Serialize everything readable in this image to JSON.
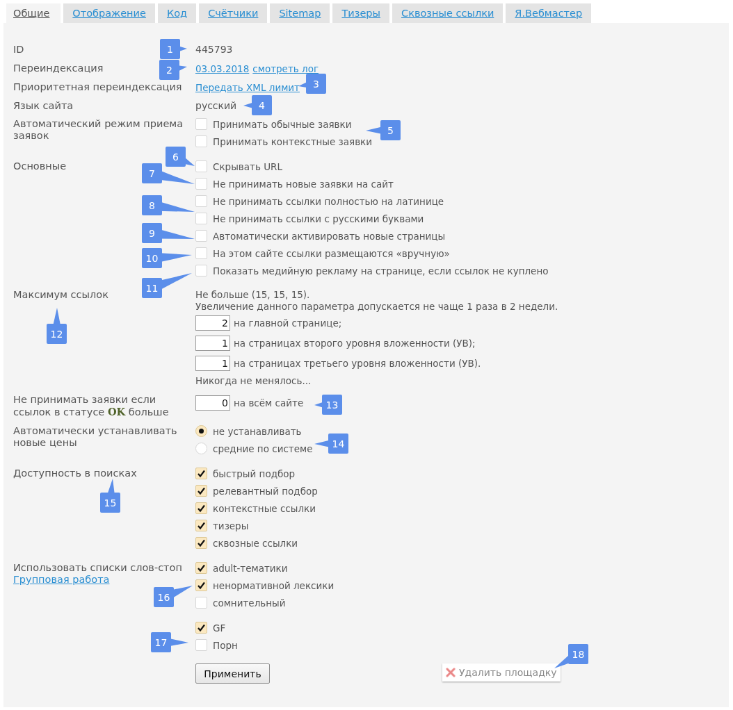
{
  "tabs": [
    {
      "label": "Общие",
      "selected": true
    },
    {
      "label": "Отображение",
      "selected": false
    },
    {
      "label": "Код",
      "selected": false
    },
    {
      "label": "Счётчики",
      "selected": false
    },
    {
      "label": "Sitemap",
      "selected": false
    },
    {
      "label": "Тизеры",
      "selected": false
    },
    {
      "label": "Сквозные ссылки",
      "selected": false
    },
    {
      "label": "Я.Вебмастер",
      "selected": false
    }
  ],
  "fields": [
    {
      "kind": "text",
      "label": "ID",
      "value": "445793"
    },
    {
      "kind": "links",
      "label": "Переиндексация",
      "links": [
        "03.03.2018",
        "смотреть лог"
      ]
    },
    {
      "kind": "links",
      "label": "Приоритетная переиндексация",
      "links": [
        "Передать XML лимит"
      ]
    },
    {
      "kind": "text",
      "label": "Язык сайта",
      "value": "русский"
    },
    {
      "kind": "checkboxes",
      "label": "Автоматический режим приема заявок",
      "options": [
        {
          "label": "Принимать обычные заявки",
          "checked": false
        },
        {
          "label": "Принимать контекстные заявки",
          "checked": false
        }
      ]
    },
    {
      "kind": "checkboxes",
      "label": "Основные",
      "options": [
        {
          "label": "Скрывать URL",
          "checked": false
        },
        {
          "label": "Не принимать новые заявки на сайт",
          "checked": false
        },
        {
          "label": "Не принимать ссылки полностью на латинице",
          "checked": false
        },
        {
          "label": "Не принимать ссылки с русскими буквами",
          "checked": false
        },
        {
          "label": "Автоматически активировать новые страницы",
          "checked": false
        },
        {
          "label": "На этом сайте ссылки размещаются «вручную»",
          "checked": false
        },
        {
          "label": "Показать медийную рекламу на странице, если ссылок не куплено",
          "checked": false
        }
      ]
    },
    {
      "kind": "limits",
      "label": "Максимум ссылок",
      "notes": [
        "Не больше (15, 15, 15).",
        "Увеличение данного параметра допускается не чаще 1 раза в 2 недели."
      ],
      "inputs": [
        {
          "value": "2",
          "caption": "на главной странице;"
        },
        {
          "value": "1",
          "caption": "на страницах второго уровня вложенности (УВ);"
        },
        {
          "value": "1",
          "caption": "на страницах третьего уровня вложенности (УВ)."
        }
      ],
      "footer": "Никогда не менялось..."
    },
    {
      "kind": "inputs",
      "label": "Не принимать заявки если ссылок в статусе **OK** больше",
      "inputs": [
        {
          "value": "0",
          "caption": "на всём сайте"
        }
      ]
    },
    {
      "kind": "radios",
      "label": "Автоматически устанавливать новые цены",
      "options": [
        {
          "label": "не устанавливать",
          "selected": true
        },
        {
          "label": "средние по системе",
          "selected": false
        }
      ]
    },
    {
      "kind": "checkboxes",
      "label": "Доступность в поисках",
      "options": [
        {
          "label": "быстрый подбор",
          "checked": true
        },
        {
          "label": "релевантный подбор",
          "checked": true
        },
        {
          "label": "контекстные ссылки",
          "checked": true
        },
        {
          "label": "тизеры",
          "checked": true
        },
        {
          "label": "сквозные ссылки",
          "checked": true
        }
      ]
    },
    {
      "kind": "checkboxes",
      "label": "Использовать списки слов-стоп",
      "link": "Групповая работа",
      "options": [
        {
          "label": "adult-тематики",
          "checked": true
        },
        {
          "label": "ненормативной лексики",
          "checked": true
        },
        {
          "label": "сомнительный",
          "checked": false
        }
      ]
    },
    {
      "kind": "checkboxes",
      "options": [
        {
          "label": "GF",
          "checked": true
        },
        {
          "label": "Порн",
          "checked": false
        }
      ]
    }
  ],
  "buttons": {
    "apply": "Применить",
    "delete": "Удалить площадку"
  },
  "callouts": [
    "1",
    "2",
    "3",
    "4",
    "5",
    "6",
    "7",
    "8",
    "9",
    "10",
    "11",
    "12",
    "13",
    "14",
    "15",
    "16",
    "17",
    "18"
  ]
}
